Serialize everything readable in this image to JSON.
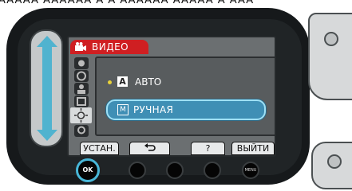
{
  "top_strip": {
    "text": "AAAAA AAAAAA A A AAAAAA AAAAA A AAA"
  },
  "screen": {
    "mode_tab": {
      "label": "ВИДЕО",
      "icon": "video-camera-icon"
    },
    "category_icons": [
      "scene-icon",
      "exposure-icon",
      "person-icon",
      "white-balance-icon",
      "adjust-icon",
      "filter-icon"
    ],
    "menu": {
      "items": [
        {
          "badge": "A",
          "label": "АВТО",
          "selected": false,
          "current": true
        },
        {
          "badge": "M",
          "label": "РУЧНАЯ",
          "selected": true,
          "current": false
        }
      ]
    },
    "soft_keys": {
      "set": "УСТАН.",
      "back_icon": "return-arrow-icon",
      "help": "?",
      "exit": "ВЫЙТИ"
    }
  },
  "hardware_buttons": {
    "ok_label": "OK",
    "menu_label": "MENU"
  },
  "colors": {
    "accent": "#50b3cf",
    "tab": "#cf1f22",
    "highlight": "#3f8fb5",
    "bullet": "#e9d33a"
  }
}
